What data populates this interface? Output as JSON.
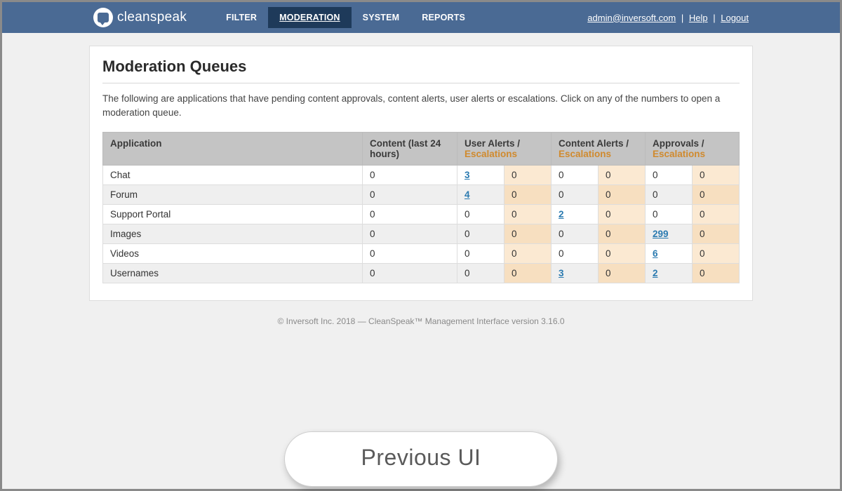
{
  "brand": {
    "name": "cleanspeak"
  },
  "nav": {
    "items": [
      "FILTER",
      "MODERATION",
      "SYSTEM",
      "REPORTS"
    ],
    "active_index": 1,
    "user_email": "admin@inversoft.com",
    "help_label": "Help",
    "logout_label": "Logout"
  },
  "page": {
    "title": "Moderation Queues",
    "description": "The following are applications that have pending content approvals, content alerts, user alerts or escalations. Click on any of the numbers to open a moderation queue."
  },
  "table": {
    "headers": {
      "application": "Application",
      "content": "Content (last 24 hours)",
      "user_alerts": "User Alerts /",
      "content_alerts": "Content Alerts /",
      "approvals": "Approvals /",
      "escalations": "Escalations"
    },
    "rows": [
      {
        "app": "Chat",
        "content": "0",
        "ua": "3",
        "ua_esc": "0",
        "ca": "0",
        "ca_esc": "0",
        "ap": "0",
        "ap_esc": "0"
      },
      {
        "app": "Forum",
        "content": "0",
        "ua": "4",
        "ua_esc": "0",
        "ca": "0",
        "ca_esc": "0",
        "ap": "0",
        "ap_esc": "0"
      },
      {
        "app": "Support Portal",
        "content": "0",
        "ua": "0",
        "ua_esc": "0",
        "ca": "2",
        "ca_esc": "0",
        "ap": "0",
        "ap_esc": "0"
      },
      {
        "app": "Images",
        "content": "0",
        "ua": "0",
        "ua_esc": "0",
        "ca": "0",
        "ca_esc": "0",
        "ap": "299",
        "ap_esc": "0"
      },
      {
        "app": "Videos",
        "content": "0",
        "ua": "0",
        "ua_esc": "0",
        "ca": "0",
        "ca_esc": "0",
        "ap": "6",
        "ap_esc": "0"
      },
      {
        "app": "Usernames",
        "content": "0",
        "ua": "0",
        "ua_esc": "0",
        "ca": "3",
        "ca_esc": "0",
        "ap": "2",
        "ap_esc": "0"
      }
    ]
  },
  "footer": {
    "text": "© Inversoft Inc. 2018 — CleanSpeak™ Management Interface version 3.16.0"
  },
  "badge": {
    "label": "Previous UI"
  }
}
